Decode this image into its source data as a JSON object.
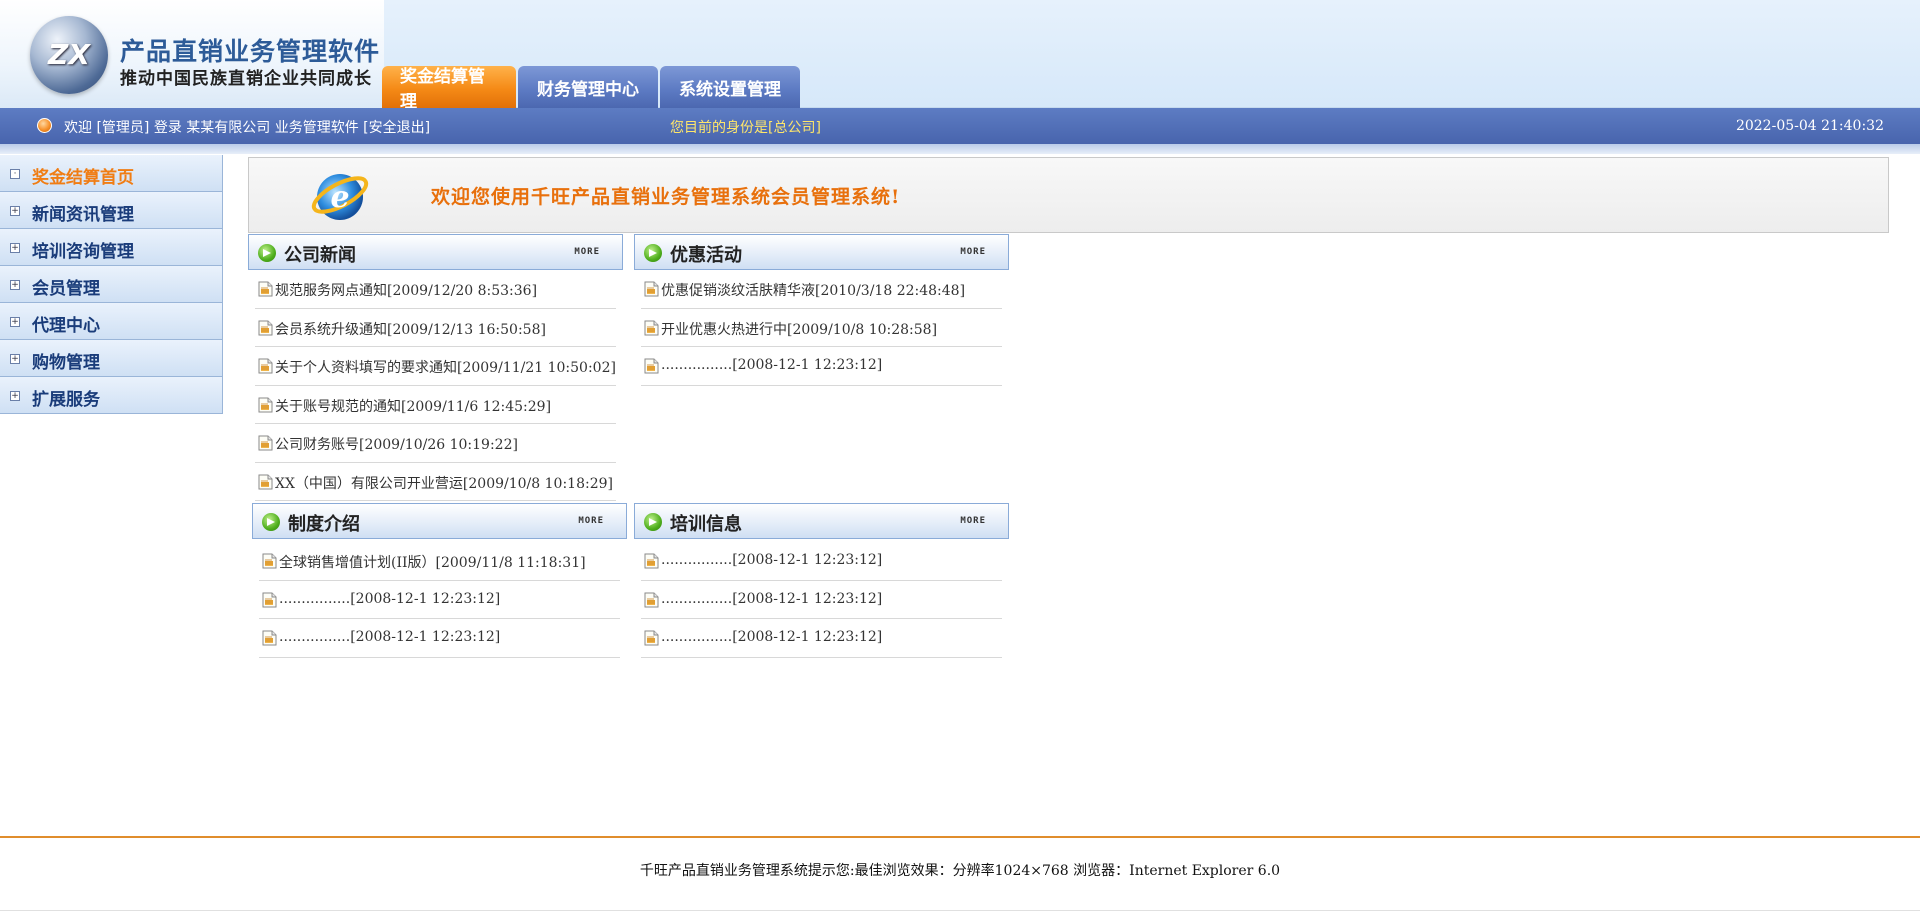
{
  "header": {
    "logo_text": "ZX",
    "title": "产品直销业务管理软件",
    "subtitle": "推动中国民族直销企业共同成长",
    "tabs": [
      {
        "label": "奖金结算管理",
        "active": true
      },
      {
        "label": "财务管理中心",
        "active": false
      },
      {
        "label": "系统设置管理",
        "active": false
      }
    ]
  },
  "status": {
    "welcome": "欢迎 [管理员] 登录 某某有限公司 业务管理软件 [安全退出]",
    "role": "您目前的身份是[总公司]",
    "datetime": "2022-05-04 21:40:32"
  },
  "sidebar": {
    "items": [
      {
        "label": "奖金结算首页",
        "icon": "collapse-box",
        "symbol": "·",
        "active": true
      },
      {
        "label": "新闻资讯管理",
        "icon": "expand-box",
        "symbol": "+"
      },
      {
        "label": "培训咨询管理",
        "icon": "expand-box",
        "symbol": "+"
      },
      {
        "label": "会员管理",
        "icon": "expand-box",
        "symbol": "+"
      },
      {
        "label": "代理中心",
        "icon": "expand-box",
        "symbol": "+"
      },
      {
        "label": "购物管理",
        "icon": "expand-box",
        "symbol": "+"
      },
      {
        "label": "扩展服务",
        "icon": "expand-box",
        "symbol": "+"
      }
    ]
  },
  "banner": {
    "message": "欢迎您使用千旺产品直销业务管理系统会员管理系统!",
    "icon": "ie-logo-icon"
  },
  "panels": {
    "more_label": "MORE",
    "company_news": {
      "title": "公司新闻",
      "items": [
        "规范服务网点通知[2009/12/20 8:53:36]",
        "会员系统升级通知[2009/12/13 16:50:58]",
        "关于个人资料填写的要求通知[2009/11/21 10:50:02]",
        "关于账号规范的通知[2009/11/6 12:45:29]",
        "公司财务账号[2009/10/26 10:19:22]",
        "XX（中国）有限公司开业营运[2009/10/8 10:18:29]"
      ]
    },
    "promotions": {
      "title": "优惠活动",
      "items": [
        "优惠促销淡纹活肤精华液[2010/3/18 22:48:48]",
        "开业优惠火热进行中[2009/10/8 10:28:58]",
        "................[2008-12-1 12:23:12]"
      ]
    },
    "policy": {
      "title": "制度介绍",
      "items": [
        "全球销售增值计划(II版）[2009/11/8 11:18:31]",
        "................[2008-12-1 12:23:12]",
        "................[2008-12-1 12:23:12]"
      ]
    },
    "training": {
      "title": "培训信息",
      "items": [
        "................[2008-12-1 12:23:12]",
        "................[2008-12-1 12:23:12]",
        "................[2008-12-1 12:23:12]"
      ]
    }
  },
  "footer": {
    "text": "千旺产品直销业务管理系统提示您:最佳浏览效果：分辨率1024×768 浏览器：Internet Explorer 6.0"
  },
  "colors": {
    "accent_orange": "#f58a16",
    "nav_blue": "#4864ad",
    "sidebar_text": "#1a3c7a",
    "role_yellow": "#ffe66a"
  }
}
